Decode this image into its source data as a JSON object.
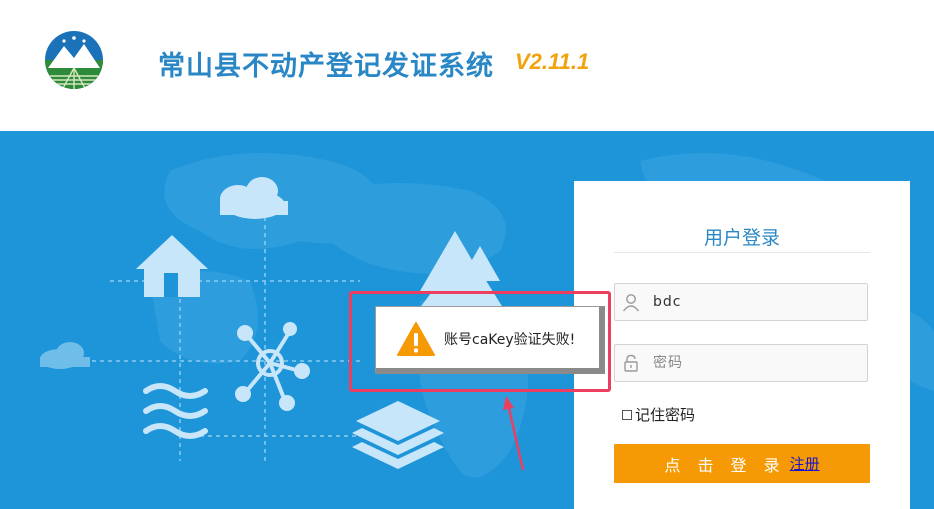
{
  "header": {
    "title": "常山县不动产登记发证系统",
    "version": "V2.11.1"
  },
  "login": {
    "title": "用户登录",
    "username_value": "bdc",
    "password_placeholder": "密码",
    "remember_label": "记住密码",
    "submit_label": "点 击 登 录",
    "register_label": "注册"
  },
  "alert": {
    "message": "账号caKey验证失败!",
    "icon": "warning-icon"
  },
  "colors": {
    "banner_bg": "#1e95d9",
    "title_blue": "#2a87c6",
    "version_orange": "#f2a20c",
    "button_orange": "#f59a05",
    "highlight_red": "#ec3e5f"
  }
}
